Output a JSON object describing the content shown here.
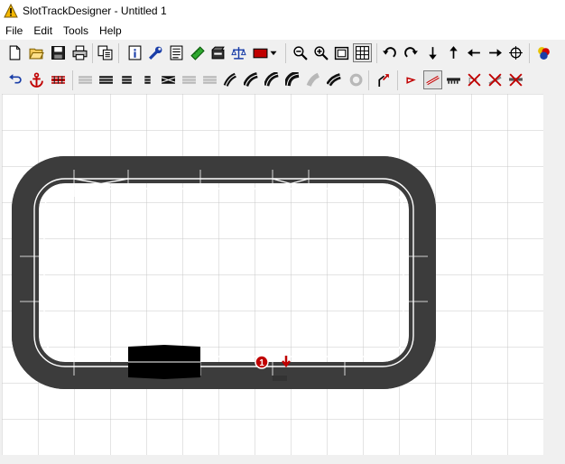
{
  "window": {
    "title": "SlotTrackDesigner - Untitled 1",
    "app_icon": "warning-triangle-icon"
  },
  "menu": {
    "items": [
      "File",
      "Edit",
      "Tools",
      "Help"
    ]
  },
  "toolbar1": {
    "buttons": [
      {
        "name": "new-document-icon"
      },
      {
        "name": "open-folder-icon"
      },
      {
        "name": "save-icon"
      },
      {
        "name": "print-icon"
      },
      {
        "name": "copy-icon"
      },
      {
        "name": "info-icon"
      },
      {
        "name": "wrench-icon"
      },
      {
        "name": "parts-list-icon"
      },
      {
        "name": "ruler-icon"
      },
      {
        "name": "scenery-icon"
      },
      {
        "name": "scales-icon"
      },
      {
        "name": "track-color-icon",
        "color": "#c00000"
      },
      {
        "name": "color-dropdown-icon"
      },
      {
        "name": "zoom-out-icon"
      },
      {
        "name": "zoom-in-icon"
      },
      {
        "name": "zoom-fit-icon"
      },
      {
        "name": "grid-icon"
      },
      {
        "name": "rotate-left-icon"
      },
      {
        "name": "rotate-right-icon"
      },
      {
        "name": "arrow-down-icon"
      },
      {
        "name": "arrow-up-icon"
      },
      {
        "name": "arrow-left-icon"
      },
      {
        "name": "arrow-right-icon"
      },
      {
        "name": "center-target-icon"
      },
      {
        "name": "palette-icon"
      }
    ]
  },
  "toolbar2": {
    "buttons": [
      {
        "name": "undo-icon"
      },
      {
        "name": "anchor-icon"
      },
      {
        "name": "track-connect-icon"
      },
      {
        "name": "straight-track-disabled-icon"
      },
      {
        "name": "straight-track-icon"
      },
      {
        "name": "straight-half-track-icon"
      },
      {
        "name": "straight-quarter-track-icon"
      },
      {
        "name": "crossover-track-icon"
      },
      {
        "name": "straight-long-disabled-icon"
      },
      {
        "name": "straight-long-disabled-2-icon"
      },
      {
        "name": "curve-1-icon"
      },
      {
        "name": "curve-2-icon"
      },
      {
        "name": "curve-3-icon"
      },
      {
        "name": "curve-4-icon"
      },
      {
        "name": "curve-disabled-icon"
      },
      {
        "name": "curve-5-icon"
      },
      {
        "name": "curve-disabled-2-icon"
      },
      {
        "name": "junction-arrow-icon"
      },
      {
        "name": "car-icon"
      },
      {
        "name": "slope-icon"
      },
      {
        "name": "barrier-icon"
      },
      {
        "name": "delete-car-icon"
      },
      {
        "name": "delete-slope-icon"
      },
      {
        "name": "delete-barrier-icon"
      }
    ]
  },
  "canvas": {
    "start_marker": "1",
    "track_color": "#3c3c3c",
    "border_color": "#007a00",
    "grid_color": "#c8c8c8"
  }
}
